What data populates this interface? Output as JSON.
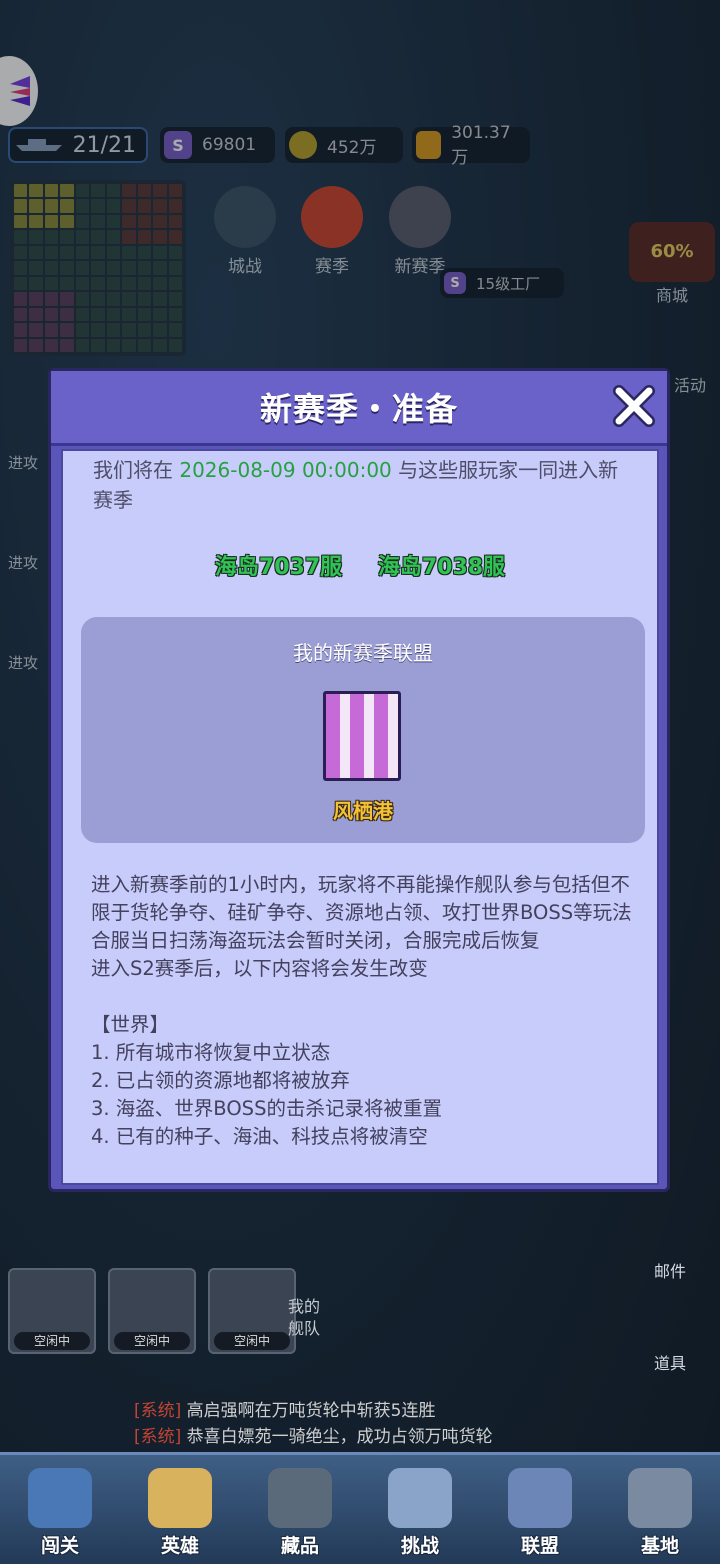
{
  "top_bar": {
    "fleet_count": "21/21",
    "silver": "69801",
    "gold": "452万",
    "oil": "301.37万"
  },
  "top_icons": [
    {
      "label": "城战"
    },
    {
      "label": "赛季"
    },
    {
      "label": "新赛季"
    }
  ],
  "factory_label": "15级工厂",
  "right_menu": {
    "shop_label": "商城",
    "shop_discount": "60%",
    "event_label": "活动",
    "mail_label": "邮件",
    "items_label": "道具"
  },
  "left_menu": {
    "attack_labels": [
      "进攻",
      "进攻",
      "进攻"
    ]
  },
  "modal": {
    "title": "新赛季・准备",
    "intro_prefix": "我们将在 ",
    "intro_date": "2026-08-09 00:00:00",
    "intro_suffix": " 与这些服玩家一同进入新赛季",
    "servers": [
      "海岛7037服",
      "海岛7038服"
    ],
    "alliance_title": "我的新赛季联盟",
    "alliance_name": "风栖港",
    "rules": [
      "进入新赛季前的1小时内，玩家将不再能操作舰队参与包括但不限于货轮争夺、硅矿争夺、资源地占领、攻打世界BOSS等玩法",
      "合服当日扫荡海盗玩法会暂时关闭，合服完成后恢复",
      "进入S2赛季后，以下内容将会发生改变",
      "",
      "【世界】",
      "1. 所有城市将恢复中立状态",
      "2. 已占领的资源地都将被放弃",
      "3. 海盗、世界BOSS的击杀记录将被重置",
      "4. 已有的种子、海油、科技点将被清空"
    ]
  },
  "fleet": {
    "label": "我的舰队",
    "statuses": [
      "空闲中",
      "空闲中",
      "空闲中"
    ]
  },
  "chat": [
    {
      "tag": "[系统]",
      "text": " 高启强啊在万吨货轮中斩获5连胜"
    },
    {
      "tag": "[系统]",
      "text": " 恭喜白嫖苑一骑绝尘，成功占领万吨货轮"
    }
  ],
  "bottom_nav": [
    {
      "label": "闯关"
    },
    {
      "label": "英雄"
    },
    {
      "label": "藏品"
    },
    {
      "label": "挑战"
    },
    {
      "label": "联盟"
    },
    {
      "label": "基地"
    }
  ],
  "colors": {
    "modal_frame": "#5a55b8",
    "modal_body": "#c8ccfa",
    "date_green": "#27a043",
    "server_green": "#2fc453",
    "alliance_gold": "#f4c236"
  }
}
